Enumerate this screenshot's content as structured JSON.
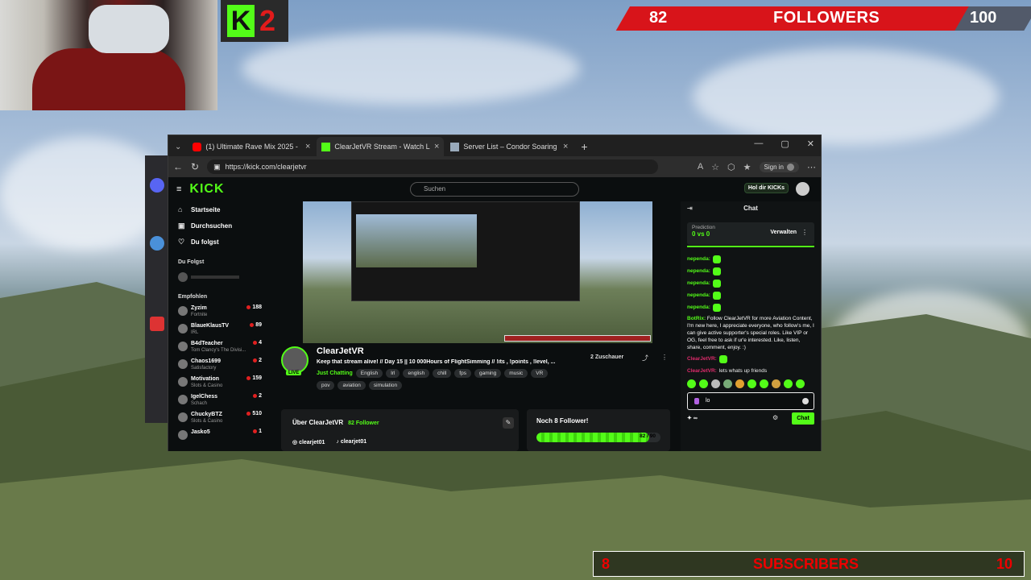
{
  "overlay": {
    "kick_badge_count": "2",
    "followers_current": "82",
    "followers_label": "FOLLOWERS",
    "followers_goal": "100",
    "followers_progress_fraction": 0.82,
    "subs_current": "8",
    "subs_label": "SUBSCRIBERS",
    "subs_goal": "10"
  },
  "browser": {
    "tabs": [
      {
        "title": "(1) Ultimate Rave Mix 2025 -",
        "icon": "youtube-icon"
      },
      {
        "title": "ClearJetVR Stream - Watch Live o",
        "icon": "kick-icon"
      },
      {
        "title": "Server List – Condor Soaring",
        "icon": "page-icon"
      }
    ],
    "url": "https://kick.com/clearjetvr",
    "signin_label": "Sign in"
  },
  "kick": {
    "logo": "KICK",
    "search_placeholder": "Suchen",
    "holdir_label": "Hol dir KICKs",
    "nav": [
      {
        "label": "Startseite",
        "icon": "home-icon"
      },
      {
        "label": "Durchsuchen",
        "icon": "browse-icon"
      },
      {
        "label": "Du folgst",
        "icon": "heart-icon"
      }
    ],
    "following_header": "Du Folgst",
    "recommended_header": "Empfohlen",
    "recommended": [
      {
        "name": "Zyzim",
        "game": "Fortnite",
        "viewers": "188"
      },
      {
        "name": "BlaueKlausTV",
        "game": "IRL",
        "viewers": "89"
      },
      {
        "name": "B4dTeacher",
        "game": "Tom Clancy's The Divisi...",
        "viewers": "4"
      },
      {
        "name": "Chaos1699",
        "game": "Satisfactory",
        "viewers": "2"
      },
      {
        "name": "Motivation",
        "game": "Slots & Casino",
        "viewers": "159"
      },
      {
        "name": "IgelChess",
        "game": "Schach",
        "viewers": "2"
      },
      {
        "name": "ChuckyBTZ",
        "game": "Slots & Casino",
        "viewers": "510"
      },
      {
        "name": "Jasko5",
        "game": "",
        "viewers": "1"
      }
    ],
    "channel": {
      "name": "ClearJetVR",
      "live": "LIVE",
      "title": "Keep that stream alive! // Day 15 || 10 000Hours of FlightSimming // !its , !points , !level, ...",
      "category": "Just Chatting",
      "tags": [
        "English",
        "Irl",
        "english",
        "chill",
        "fps",
        "gaming",
        "music",
        "VR",
        "pov",
        "aviation",
        "simulation"
      ],
      "viewers": "2 Zuschauer"
    },
    "about": {
      "title": "Über ClearJetVR",
      "followers": "82 Follower",
      "instagram": "clearjet01",
      "tiktok": "clearjet01"
    },
    "goal": {
      "title": "Noch 8 Follower!",
      "value": "82 / 90",
      "fraction": 0.911
    },
    "chat": {
      "header": "Chat",
      "prediction_label": "Prediction",
      "prediction_score": "0 vs 0",
      "prediction_manage": "Verwalten",
      "messages": [
        {
          "user": "nependa:"
        },
        {
          "user": "nependa:"
        },
        {
          "user": "nependa:"
        },
        {
          "user": "nependa:"
        },
        {
          "user": "nependa:"
        }
      ],
      "bot_user": "BotRix:",
      "bot_text": "Follow ClearJetVR for more Aviation Content, I'm new here, I appreciate everyone, who follow's me, I can give active supporter's special roles. Like VIP or OG, feel free to ask if ur'e interested. Like, listen, share, comment, enjoy. :)",
      "msg2_user": "ClearJetVR:",
      "msg3_user": "ClearJetVR:",
      "msg3_text": "lets whats up friends",
      "input_value": "lo",
      "points": "∞",
      "send_label": "Chat"
    }
  },
  "colors": {
    "kick_green": "#53fc18",
    "followers_red": "#d8141a"
  }
}
